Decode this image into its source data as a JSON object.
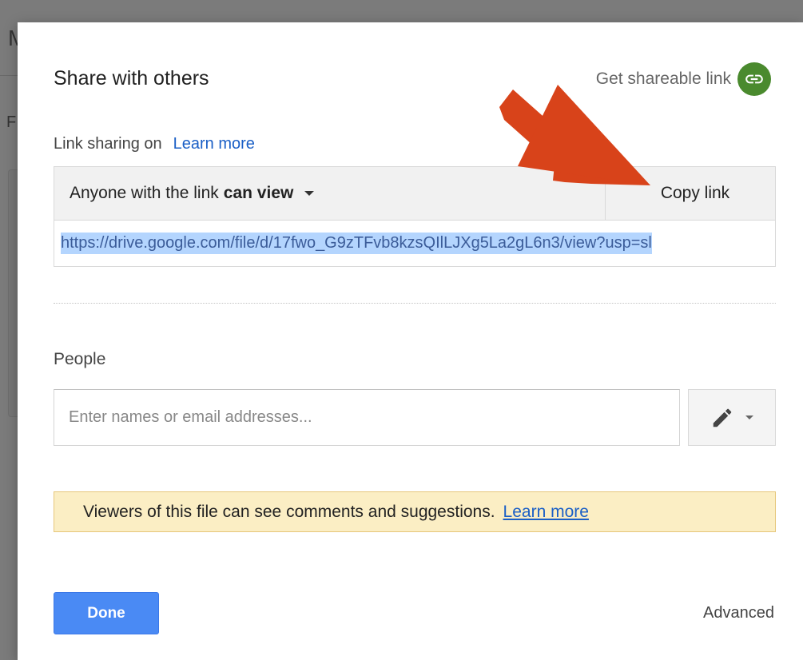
{
  "background": {
    "letter_top": "M",
    "letter_side": "F"
  },
  "dialog": {
    "title": "Share with others",
    "get_link_label": "Get shareable link",
    "get_link_icon": "link-icon",
    "link_sharing_status": "Link sharing on",
    "link_learn_more": "Learn more",
    "access": {
      "prefix": "Anyone with the link",
      "permission": "can view"
    },
    "copy_link_label": "Copy link",
    "share_url": "https://drive.google.com/file/d/17fwo_G9zTFvb8kzsQIlLJXg5La2gL6n3/view?usp=sl",
    "people_label": "People",
    "people_placeholder": "Enter names or email addresses...",
    "permission_icon": "pencil-icon",
    "notice_text": "Viewers of this file can see comments and suggestions.",
    "notice_learn_more": "Learn more",
    "done_label": "Done",
    "advanced_label": "Advanced"
  },
  "colors": {
    "accent_blue": "#4a8af4",
    "link_green": "#4a8a2e",
    "notice_bg": "#fbeec4",
    "arrow_red": "#d8431a",
    "link_text_blue": "#1a5fc6"
  }
}
